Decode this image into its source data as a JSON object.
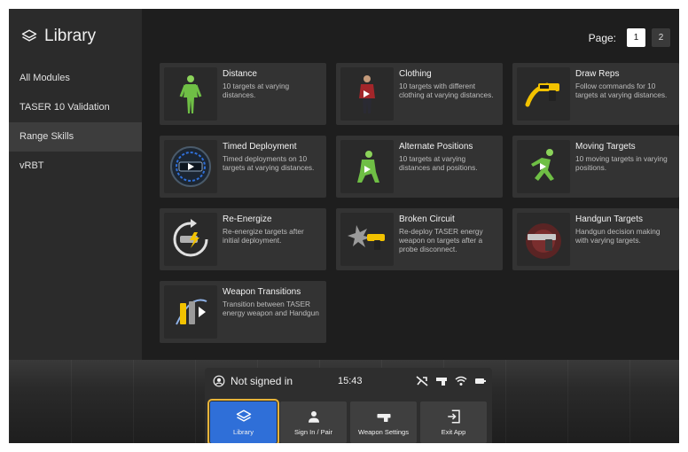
{
  "sidebar": {
    "title": "Library",
    "items": [
      {
        "label": "All Modules"
      },
      {
        "label": "TASER 10 Validation"
      },
      {
        "label": "Range Skills"
      },
      {
        "label": "vRBT"
      }
    ]
  },
  "pager": {
    "label": "Page:",
    "pages": [
      "1",
      "2"
    ],
    "current": "1"
  },
  "modules": [
    {
      "title": "Distance",
      "desc": "10 targets at varying distances."
    },
    {
      "title": "Clothing",
      "desc": "10 targets with different clothing at varying distances."
    },
    {
      "title": "Draw Reps",
      "desc": "Follow commands for 10 targets at varying distances."
    },
    {
      "title": "Timed Deployment",
      "desc": "Timed deployments on 10 targets at varying distances."
    },
    {
      "title": "Alternate Positions",
      "desc": "10 targets at varying distances and positions."
    },
    {
      "title": "Moving Targets",
      "desc": "10 moving targets in varying positions."
    },
    {
      "title": "Re-Energize",
      "desc": "Re-energize targets after initial deployment."
    },
    {
      "title": "Broken Circuit",
      "desc": "Re-deploy TASER energy weapon on targets after a probe disconnect."
    },
    {
      "title": "Handgun Targets",
      "desc": "Handgun decision making with varying targets."
    },
    {
      "title": "Weapon Transitions",
      "desc": "Transition between TASER energy weapon and Handgun"
    }
  ],
  "dock": {
    "user_status": "Not signed in",
    "time": "15:43",
    "buttons": [
      {
        "label": "Library"
      },
      {
        "label": "Sign In / Pair"
      },
      {
        "label": "Weapon Settings"
      },
      {
        "label": "Exit App"
      }
    ]
  },
  "colors": {
    "accent": "#2f6fd8",
    "highlight": "#e7b43a",
    "taser_yellow": "#f2c200",
    "target_green": "#7ec850"
  }
}
